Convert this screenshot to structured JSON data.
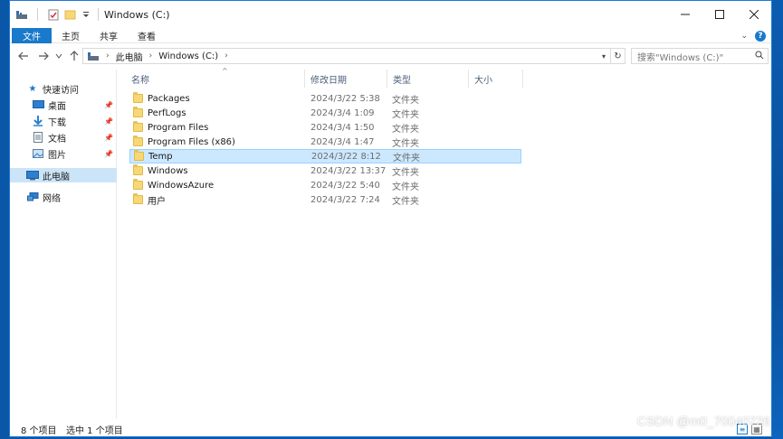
{
  "window": {
    "title": "Windows (C:)"
  },
  "ribbon": {
    "tabs": [
      {
        "label": "文件",
        "active": true
      },
      {
        "label": "主页",
        "active": false
      },
      {
        "label": "共享",
        "active": false
      },
      {
        "label": "查看",
        "active": false
      }
    ]
  },
  "address": {
    "crumbs": [
      "此电脑",
      "Windows (C:)"
    ]
  },
  "search": {
    "placeholder": "搜索\"Windows (C:)\""
  },
  "navpane": {
    "quick_access": "快速访问",
    "items": [
      {
        "label": "桌面",
        "icon": "desktop-icon",
        "pinned": true
      },
      {
        "label": "下载",
        "icon": "download-icon",
        "pinned": true
      },
      {
        "label": "文档",
        "icon": "documents-icon",
        "pinned": true
      },
      {
        "label": "图片",
        "icon": "pictures-icon",
        "pinned": true
      }
    ],
    "this_pc": "此电脑",
    "network": "网络"
  },
  "columns": {
    "name": "名称",
    "date": "修改日期",
    "type": "类型",
    "size": "大小"
  },
  "files": [
    {
      "name": "Packages",
      "date": "2024/3/22 5:38",
      "type": "文件夹",
      "selected": false
    },
    {
      "name": "PerfLogs",
      "date": "2024/3/4 1:09",
      "type": "文件夹",
      "selected": false
    },
    {
      "name": "Program Files",
      "date": "2024/3/4 1:50",
      "type": "文件夹",
      "selected": false
    },
    {
      "name": "Program Files (x86)",
      "date": "2024/3/4 1:47",
      "type": "文件夹",
      "selected": false
    },
    {
      "name": "Temp",
      "date": "2024/3/22 8:12",
      "type": "文件夹",
      "selected": true
    },
    {
      "name": "Windows",
      "date": "2024/3/22 13:37",
      "type": "文件夹",
      "selected": false
    },
    {
      "name": "WindowsAzure",
      "date": "2024/3/22 5:40",
      "type": "文件夹",
      "selected": false
    },
    {
      "name": "用户",
      "date": "2024/3/22 7:24",
      "type": "文件夹",
      "selected": false
    }
  ],
  "status": {
    "count": "8 个项目",
    "selected": "选中 1 个项目"
  },
  "watermark": "CSDN @m0_70040726",
  "colors": {
    "accent": "#1979ca",
    "selected_row": "#cce8ff",
    "folder": "#f8d775"
  }
}
